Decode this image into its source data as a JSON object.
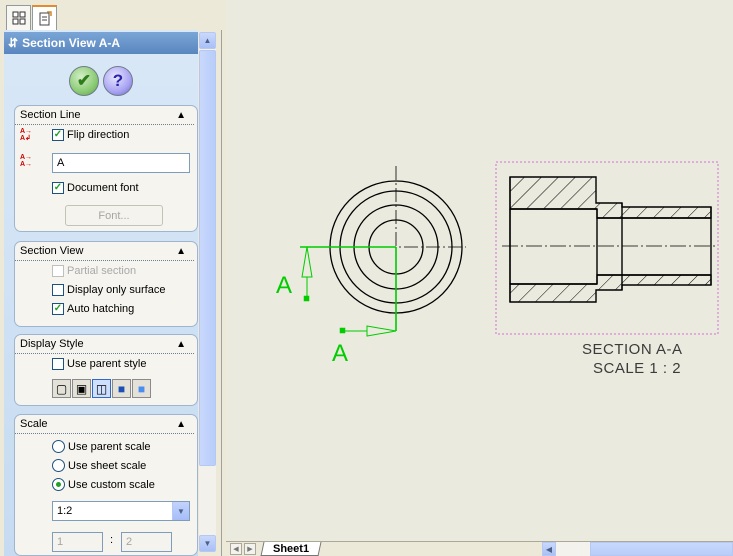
{
  "tabs": [
    {
      "name": "feature-manager-tab",
      "icon": "tree-icon"
    },
    {
      "name": "property-manager-tab",
      "icon": "property-sheet-icon"
    }
  ],
  "panel": {
    "title": "Section View A-A",
    "ok_icon": "checkmark-icon",
    "help_icon": "question-icon"
  },
  "section_line": {
    "header": "Section Line",
    "flip_direction": {
      "label": "Flip direction",
      "checked": true
    },
    "label_value": "A",
    "document_font": {
      "label": "Document font",
      "checked": true
    },
    "font_button": "Font..."
  },
  "section_view": {
    "header": "Section View",
    "partial_section": {
      "label": "Partial section",
      "checked": false,
      "disabled": true
    },
    "display_only_surface": {
      "label": "Display only surface",
      "checked": false
    },
    "auto_hatching": {
      "label": "Auto hatching",
      "checked": true
    }
  },
  "display_style": {
    "header": "Display Style",
    "use_parent_style": {
      "label": "Use parent style",
      "checked": false
    },
    "styles": [
      "wireframe",
      "hidden-lines-visible",
      "hidden-lines-removed",
      "shaded-with-edges",
      "shaded"
    ],
    "selected_style": "hidden-lines-removed"
  },
  "scale": {
    "header": "Scale",
    "options": [
      "Use parent scale",
      "Use sheet scale",
      "Use custom scale"
    ],
    "selected": "Use custom scale",
    "custom_value": "1:2",
    "numerator": "1",
    "separator": ":",
    "denominator": "2"
  },
  "drawing": {
    "section_label_left": "A",
    "section_label_bottom": "A",
    "caption_line1": "SECTION A-A",
    "caption_line2": "SCALE 1 : 2",
    "accent_color": "#00cc00",
    "selection_color": "#d46fd4"
  },
  "sheet_tab": "Sheet1"
}
